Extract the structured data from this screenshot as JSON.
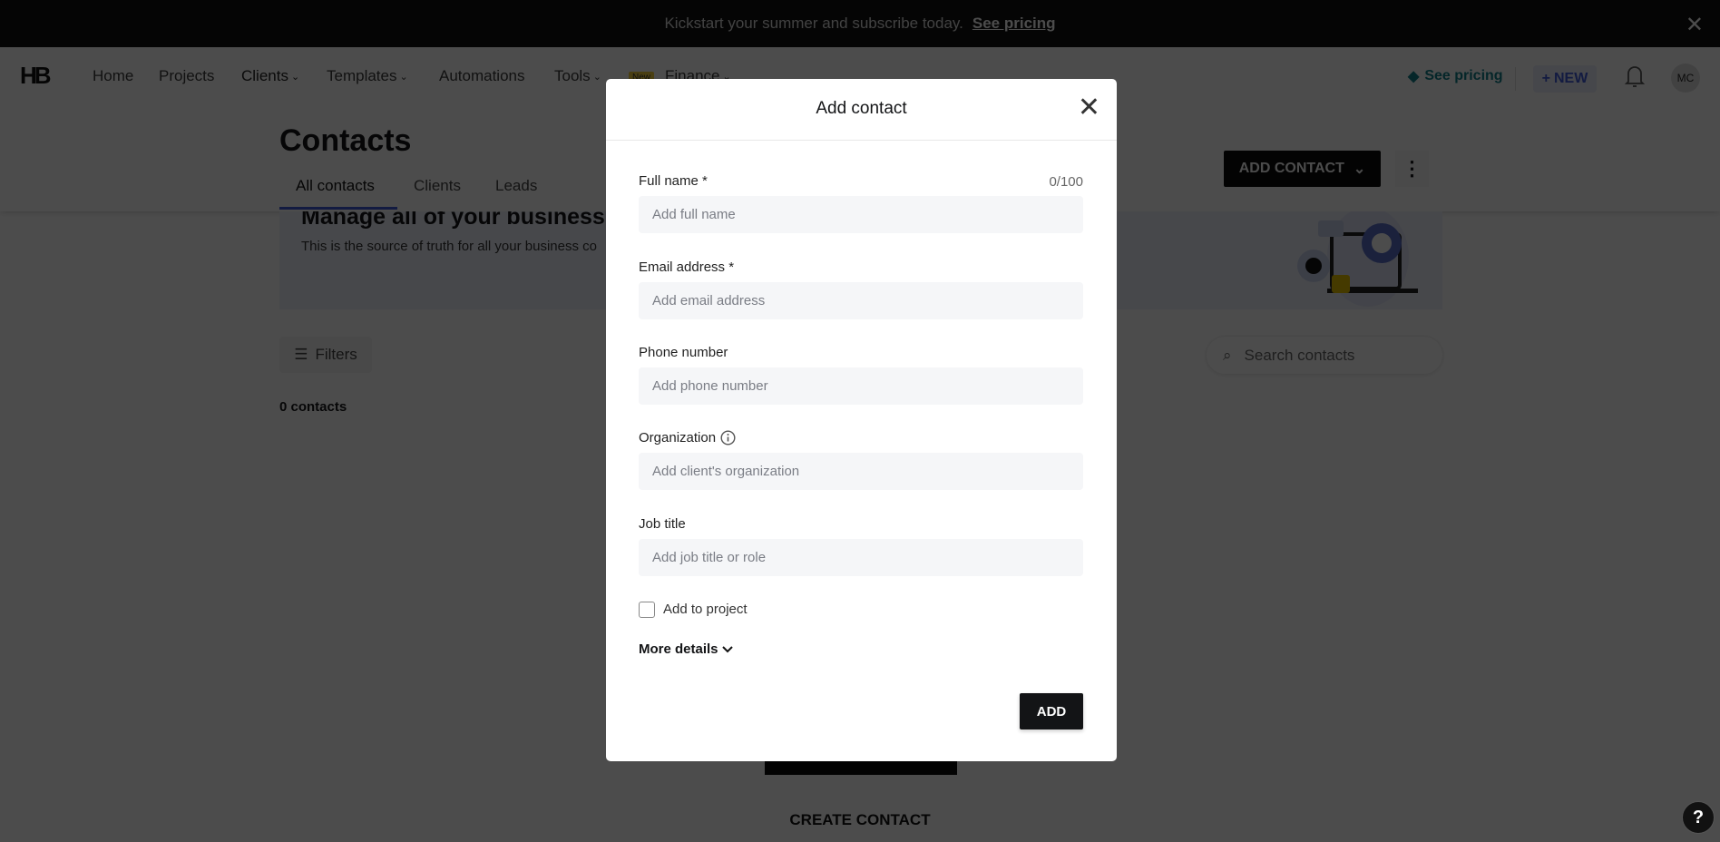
{
  "promo": {
    "text": "Kickstart your summer and subscribe today.",
    "link": "See pricing"
  },
  "nav": {
    "logo": "HB",
    "items": [
      {
        "label": "Home"
      },
      {
        "label": "Projects"
      },
      {
        "label": "Clients"
      },
      {
        "label": "Templates"
      },
      {
        "label": "Automations"
      },
      {
        "label": "Tools"
      },
      {
        "label": "Finance"
      }
    ],
    "new_badge": "New",
    "see_pricing": "See pricing",
    "new_button": "NEW",
    "avatar": "MC"
  },
  "page": {
    "title": "Contacts",
    "tabs": [
      {
        "label": "All contacts",
        "active": true
      },
      {
        "label": "Clients"
      },
      {
        "label": "Leads"
      }
    ],
    "add_contact": "ADD CONTACT",
    "banner_heading": "Manage all of your business",
    "banner_text": "This is the source of truth for all your business co",
    "filters": "Filters",
    "search_placeholder": "Search contacts",
    "count": "0 contacts",
    "create_contact": "CREATE CONTACT",
    "help": "?"
  },
  "modal": {
    "title": "Add contact",
    "counter": "0/100",
    "fields": [
      {
        "label": "Full name *",
        "placeholder": "Add full name"
      },
      {
        "label": "Email address *",
        "placeholder": "Add email address"
      },
      {
        "label": "Phone number",
        "placeholder": "Add phone number"
      },
      {
        "label": "Organization",
        "placeholder": "Add client's organization"
      },
      {
        "label": "Job title",
        "placeholder": "Add job title or role"
      }
    ],
    "checkbox": "Add to project",
    "checked": false,
    "more_details": "More details",
    "add": "ADD"
  },
  "colors": {
    "accent": "#3f5bd9",
    "pricing": "#0f7d8a",
    "badge": "#f7d23b"
  }
}
